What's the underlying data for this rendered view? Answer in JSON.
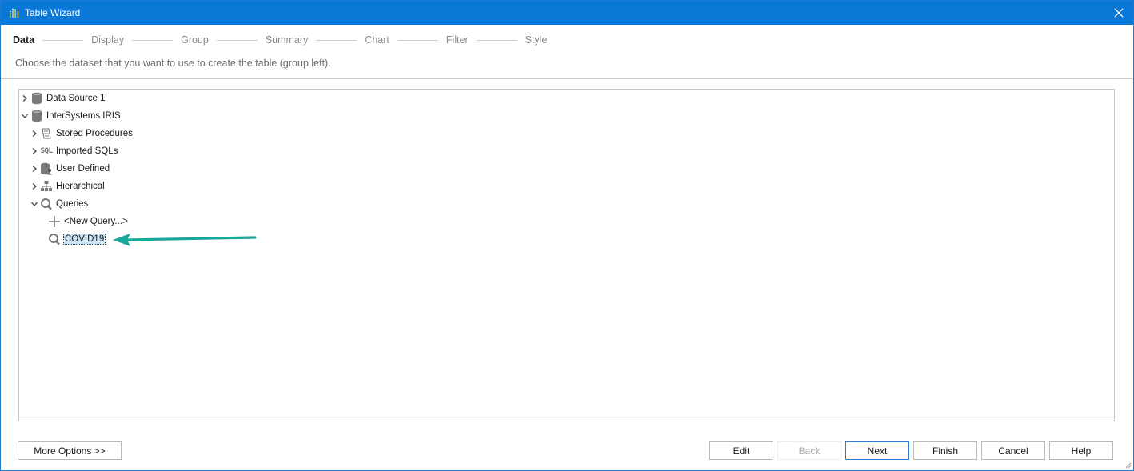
{
  "window": {
    "title": "Table Wizard",
    "app_icon": "chart-icon"
  },
  "steps": [
    {
      "label": "Data",
      "active": true
    },
    {
      "label": "Display",
      "active": false
    },
    {
      "label": "Group",
      "active": false
    },
    {
      "label": "Summary",
      "active": false
    },
    {
      "label": "Chart",
      "active": false
    },
    {
      "label": "Filter",
      "active": false
    },
    {
      "label": "Style",
      "active": false
    }
  ],
  "instruction": "Choose the dataset that you want to use to create the table (group left).",
  "tree": {
    "nodes": [
      {
        "label": "Data Source 1",
        "icon": "database-icon",
        "expanded": false,
        "level": 0
      },
      {
        "label": "InterSystems IRIS",
        "icon": "database-icon",
        "expanded": true,
        "level": 0
      },
      {
        "label": "Stored Procedures",
        "icon": "scroll-icon",
        "expanded": false,
        "level": 1
      },
      {
        "label": "Imported SQLs",
        "icon": "sql-icon",
        "icon_text": "SQL",
        "expanded": false,
        "level": 1
      },
      {
        "label": "User Defined",
        "icon": "database-user-icon",
        "expanded": false,
        "level": 1
      },
      {
        "label": "Hierarchical",
        "icon": "hierarchy-icon",
        "expanded": false,
        "level": 1
      },
      {
        "label": "Queries",
        "icon": "query-icon",
        "expanded": true,
        "level": 1
      },
      {
        "label": "<New Query...>",
        "icon": "plus-icon",
        "level": 2
      },
      {
        "label": "COVID19",
        "icon": "query-icon",
        "level": 2,
        "selected": true
      }
    ]
  },
  "annotation": {
    "color": "#1aa79b",
    "icon": "arrow-left-icon"
  },
  "buttons": {
    "more_options": "More Options >>",
    "edit": "Edit",
    "back": "Back",
    "next": "Next",
    "finish": "Finish",
    "cancel": "Cancel",
    "help": "Help"
  },
  "colors": {
    "titlebar": "#0a78d7",
    "selection": "#cde6f7",
    "default_button_border": "#2a7fd4"
  }
}
